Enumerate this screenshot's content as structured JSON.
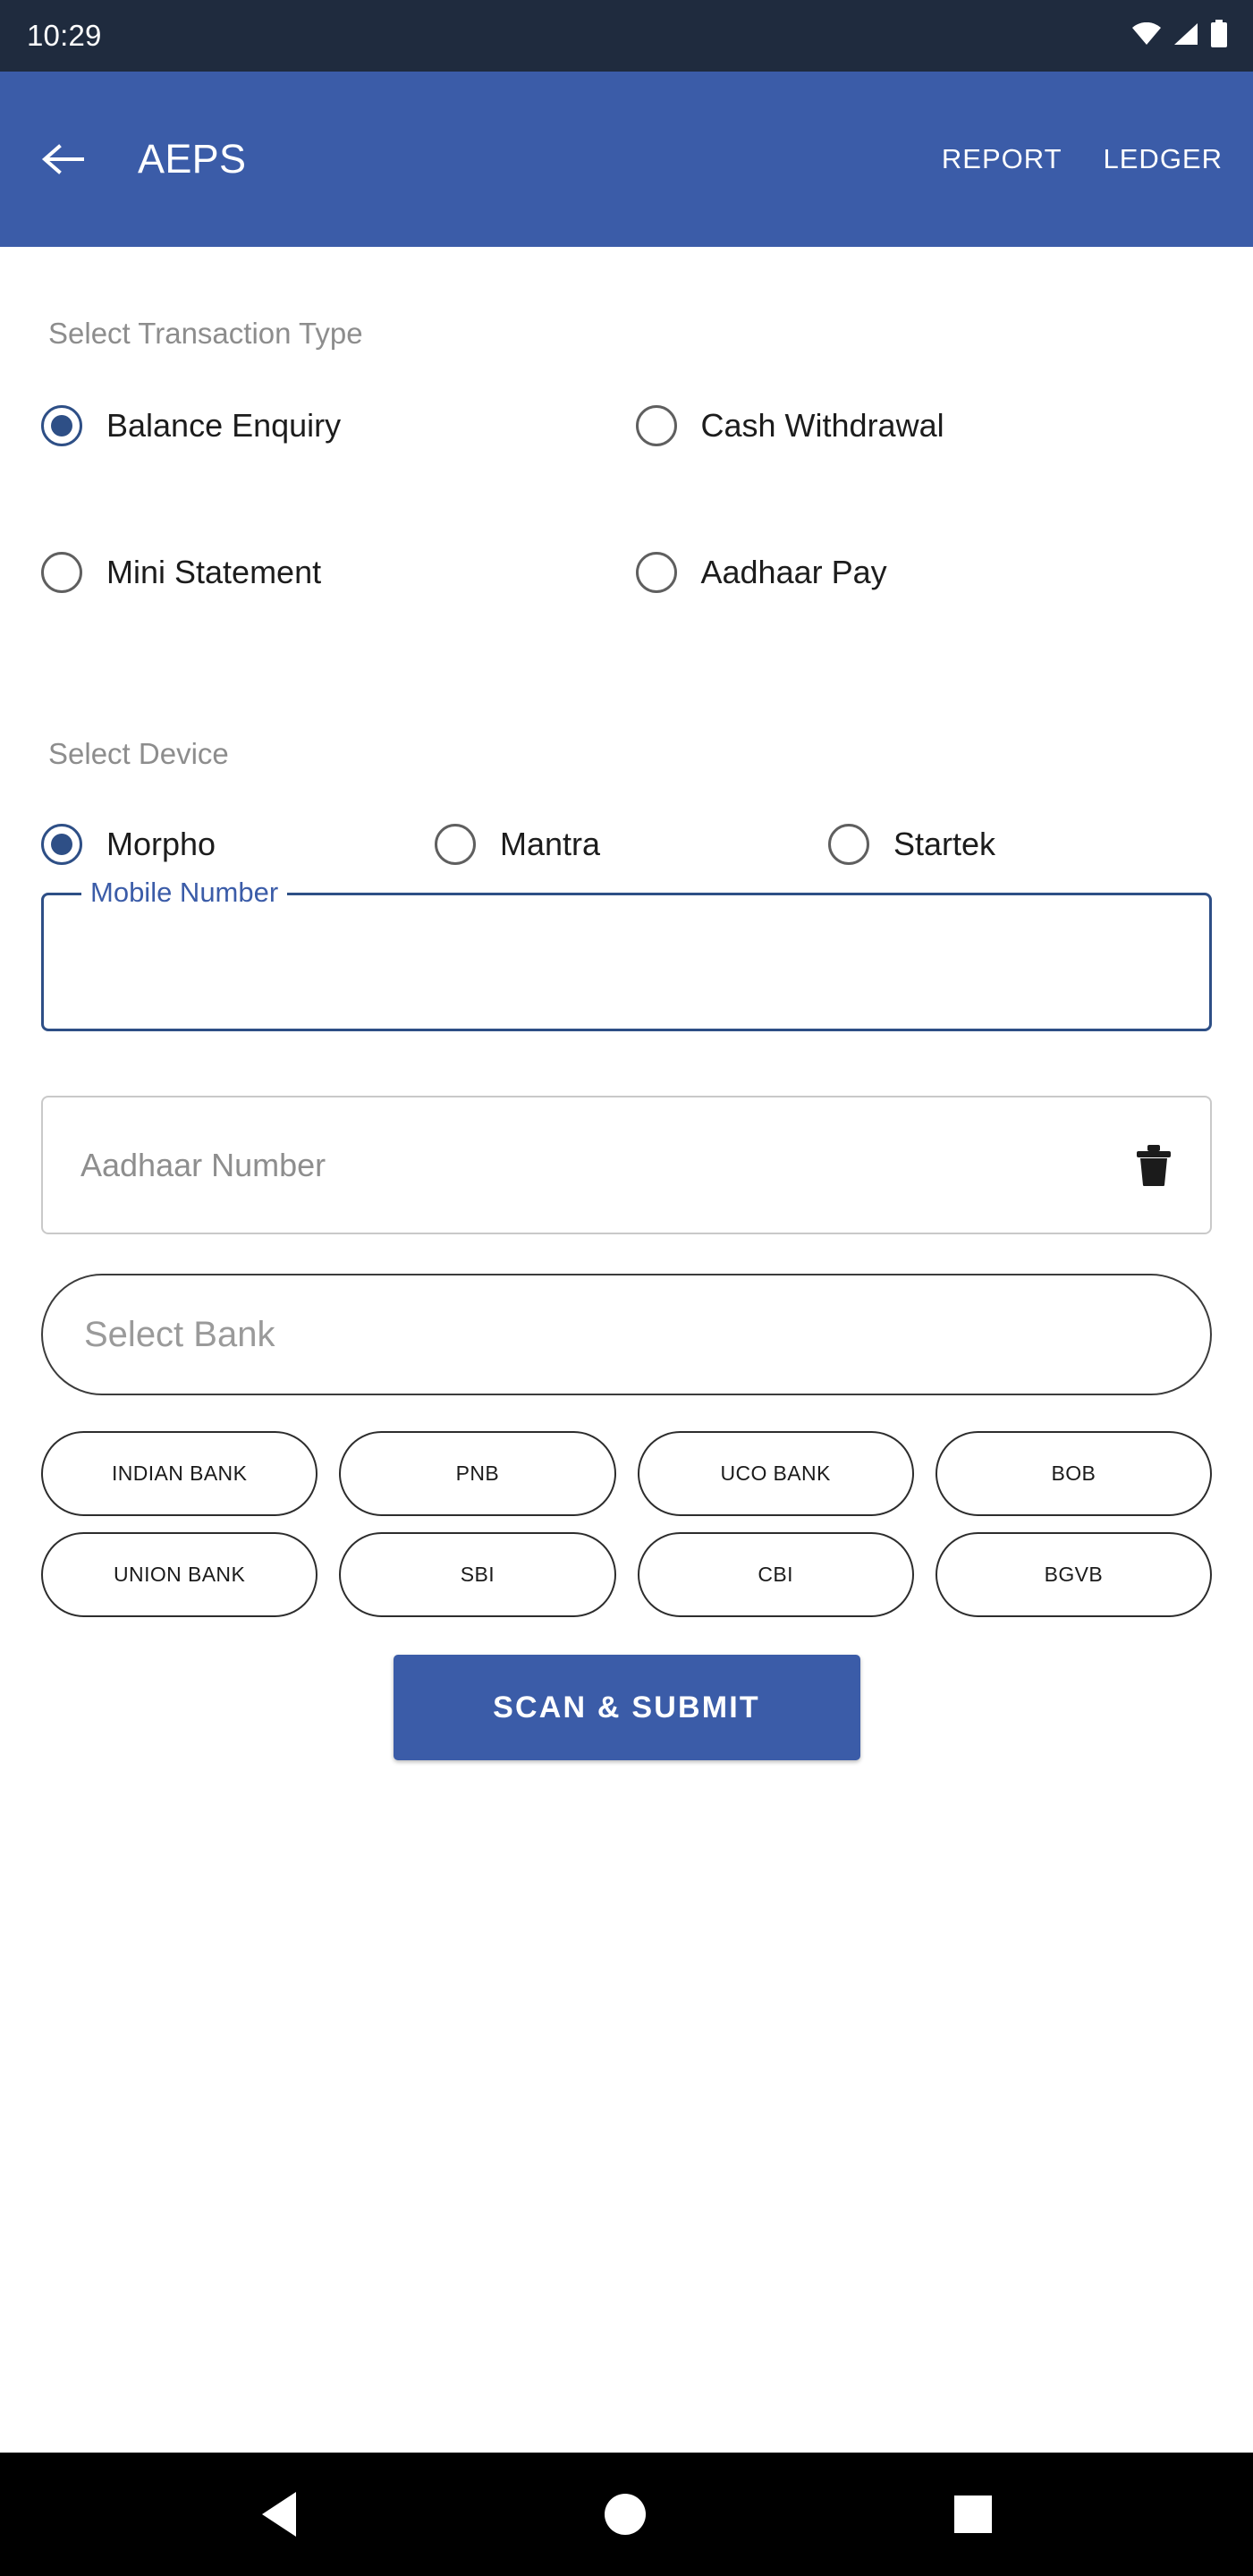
{
  "status_bar": {
    "time": "10:29",
    "icons": [
      "wifi-icon",
      "cellular-signal-icon",
      "battery-icon"
    ]
  },
  "app_bar": {
    "back_icon": "arrow-left-icon",
    "title": "AEPS",
    "actions": [
      {
        "label": "REPORT"
      },
      {
        "label": "LEDGER"
      }
    ],
    "background_color": "#3b5ca8"
  },
  "transaction_type": {
    "section_label": "Select Transaction Type",
    "options": [
      {
        "label": "Balance Enquiry",
        "selected": true
      },
      {
        "label": "Cash Withdrawal",
        "selected": false
      },
      {
        "label": "Mini Statement",
        "selected": false
      },
      {
        "label": "Aadhaar Pay",
        "selected": false
      }
    ]
  },
  "device": {
    "section_label": "Select Device",
    "options": [
      {
        "label": "Morpho",
        "selected": true
      },
      {
        "label": "Mantra",
        "selected": false
      },
      {
        "label": "Startek",
        "selected": false
      }
    ]
  },
  "form": {
    "mobile_number": {
      "floating_label": "Mobile Number",
      "value": "",
      "focused": true,
      "accent_color": "#2e4f86"
    },
    "aadhaar_number": {
      "placeholder": "Aadhaar Number",
      "value": "",
      "trailing_icon": "trash-icon"
    },
    "select_bank": {
      "placeholder": "Select Bank",
      "value": ""
    }
  },
  "bank_chips": [
    {
      "label": "INDIAN BANK"
    },
    {
      "label": "PNB"
    },
    {
      "label": "UCO BANK"
    },
    {
      "label": "BOB"
    },
    {
      "label": "UNION BANK"
    },
    {
      "label": "SBI"
    },
    {
      "label": "CBI"
    },
    {
      "label": "BGVB"
    }
  ],
  "submit": {
    "label": "SCAN & SUBMIT",
    "color": "#3b5ca8"
  },
  "nav_bar": {
    "items": [
      "back-triangle-icon",
      "home-circle-icon",
      "recents-square-icon"
    ]
  }
}
